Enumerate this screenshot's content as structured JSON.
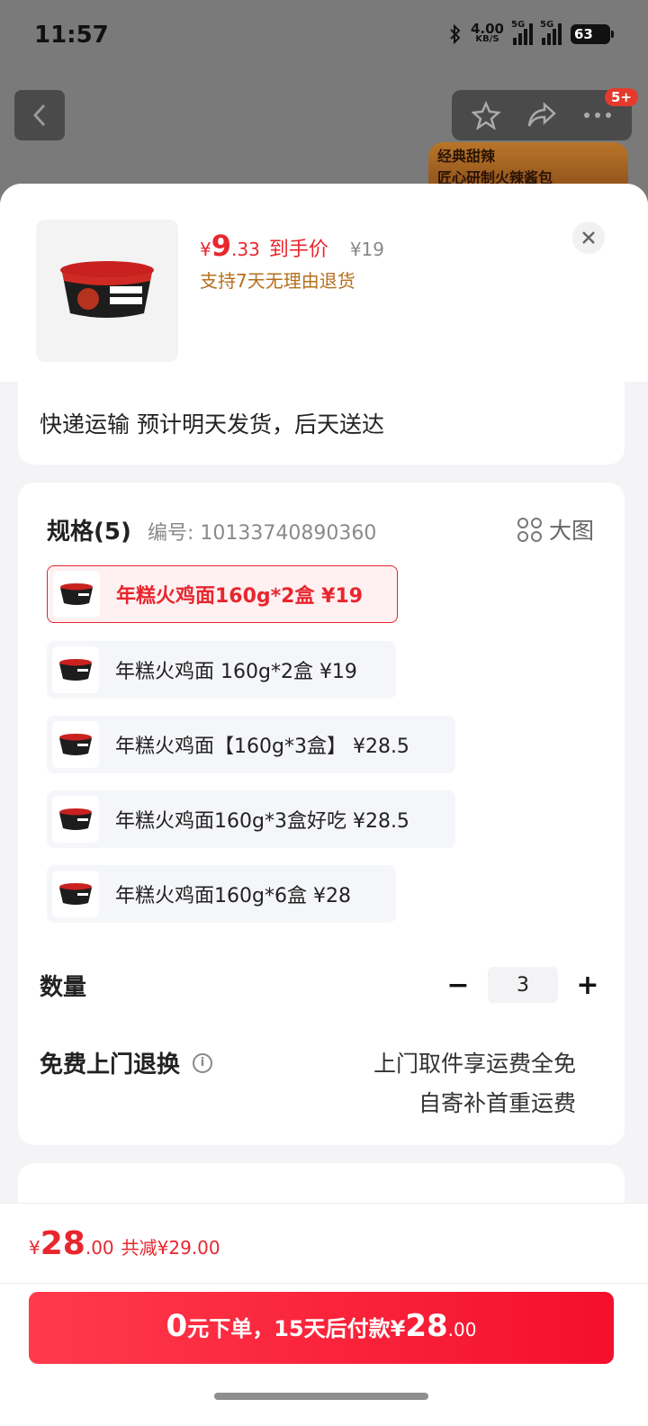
{
  "status_bar": {
    "time": "11:57",
    "net_speed": "4.00",
    "net_unit": "KB/S",
    "signal1_label": "5G",
    "signal2_label": "5G",
    "battery": "63"
  },
  "nav": {
    "badge": "5+",
    "banner_line1": "经典甜辣",
    "banner_line2": "匠心研制火辣酱包"
  },
  "product": {
    "price_currency": "¥",
    "price_int": "9",
    "price_dec": ".33",
    "price_label": "到手价",
    "original_price": "¥19",
    "return_note": "支持7天无理由退货",
    "thumb_text": "年糕火鸡面"
  },
  "delivery": {
    "text": "快递运输 预计明天发货，后天送达"
  },
  "spec": {
    "title": "规格(5)",
    "code": "编号: 10133740890360",
    "big_view_label": "大图",
    "options": [
      {
        "label": "年糕火鸡面160g*2盒  ¥19",
        "selected": true
      },
      {
        "label": "年糕火鸡面 160g*2盒  ¥19",
        "selected": false
      },
      {
        "label": "年糕火鸡面【160g*3盒】  ¥28.5",
        "selected": false
      },
      {
        "label": "年糕火鸡面160g*3盒好吃  ¥28.5",
        "selected": false
      },
      {
        "label": "年糕火鸡面160g*6盒  ¥28",
        "selected": false
      }
    ]
  },
  "quantity": {
    "label": "数量",
    "value": "3",
    "minus": "−",
    "plus": "+"
  },
  "free_return": {
    "label": "免费上门退换",
    "line1": "上门取件享运费全免",
    "line2": "自寄补首重运费"
  },
  "footer": {
    "total_currency": "¥",
    "total_int": "28",
    "total_dec": ".00",
    "saved": "共减¥29.00",
    "order_zero": "0",
    "order_text": "元下单，15天后付款¥",
    "order_int": "28",
    "order_dec": ".00"
  },
  "colors": {
    "accent": "#e8262e",
    "note": "#b5701d"
  }
}
